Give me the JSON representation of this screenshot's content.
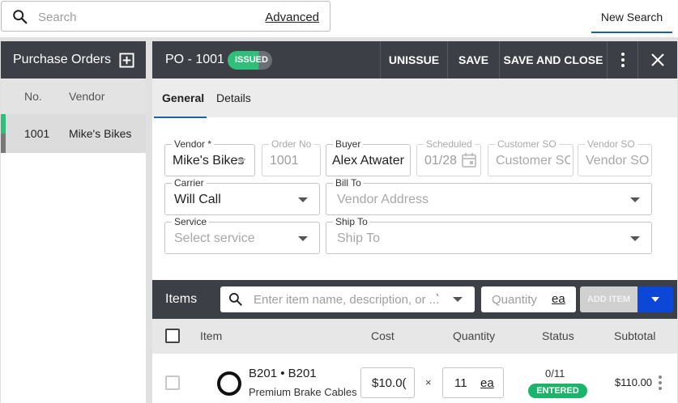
{
  "search": {
    "placeholder": "Search",
    "advanced_label": "Advanced",
    "new_search_label": "New Search"
  },
  "left_panel": {
    "title": "Purchase Orders",
    "columns": {
      "no": "No.",
      "vendor": "Vendor"
    },
    "rows": [
      {
        "no": "1001",
        "vendor": "Mike's Bikes"
      }
    ]
  },
  "header": {
    "title": "PO - 1001",
    "status": "ISSUED",
    "actions": {
      "unissue": "UNISSUE",
      "save": "SAVE",
      "save_close": "SAVE AND CLOSE"
    }
  },
  "tabs": [
    {
      "label": "General"
    },
    {
      "label": "Details"
    }
  ],
  "form": {
    "vendor": {
      "label": "Vendor *",
      "value": "Mike's Bikes"
    },
    "order_no": {
      "label": "Order No",
      "value": "1001"
    },
    "buyer": {
      "label": "Buyer",
      "value": "Alex Atwater"
    },
    "scheduled": {
      "label": "Scheduled",
      "value": "01/28"
    },
    "customer_so": {
      "label": "Customer SO",
      "placeholder": "Customer SO"
    },
    "vendor_so": {
      "label": "Vendor SO",
      "placeholder": "Vendor SO"
    },
    "carrier": {
      "label": "Carrier",
      "value": "Will Call"
    },
    "bill_to": {
      "label": "Bill To",
      "placeholder": "Vendor Address"
    },
    "service": {
      "label": "Service",
      "placeholder": "Select service"
    },
    "ship_to": {
      "label": "Ship To",
      "placeholder": "Ship To"
    }
  },
  "items": {
    "title": "Items",
    "search_placeholder": "Enter item name, description, or ...",
    "search_dropdown_value": "` ",
    "quantity_placeholder": "Quantity",
    "unit": "ea",
    "add_label": "ADD ITEM",
    "columns": {
      "item": "Item",
      "cost": "Cost",
      "quantity": "Quantity",
      "status": "Status",
      "subtotal": "Subtotal"
    },
    "rows": [
      {
        "sku": "B201 • B201",
        "description": "Premium Brake Cables",
        "cost": "$10.0(",
        "times": "×",
        "quantity": "11",
        "unit": "ea",
        "received": "0/11",
        "status": "ENTERED",
        "subtotal": "$110.00"
      }
    ]
  },
  "colors": {
    "header_bg": "#3c3f46",
    "accent_blue": "#1f5fa8",
    "status_green": "#2fbf7b",
    "add_blue": "#0d47d8"
  }
}
